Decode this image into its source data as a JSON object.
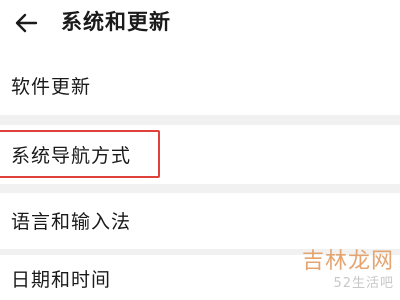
{
  "header": {
    "back_icon": "arrow-left-icon",
    "title": "系统和更新"
  },
  "settings": {
    "items": [
      {
        "label": "软件更新"
      },
      {
        "label": "系统导航方式",
        "highlighted": true
      },
      {
        "label": "语言和输入法"
      },
      {
        "label": "日期和时间"
      }
    ]
  },
  "colors": {
    "highlight_border": "#e0413a",
    "divider": "#f1f1f1",
    "watermark_main": "#e3a06a",
    "watermark_sub": "#c8c8c8"
  },
  "watermark": {
    "main": "吉林龙网",
    "sub": "52生活吧"
  }
}
